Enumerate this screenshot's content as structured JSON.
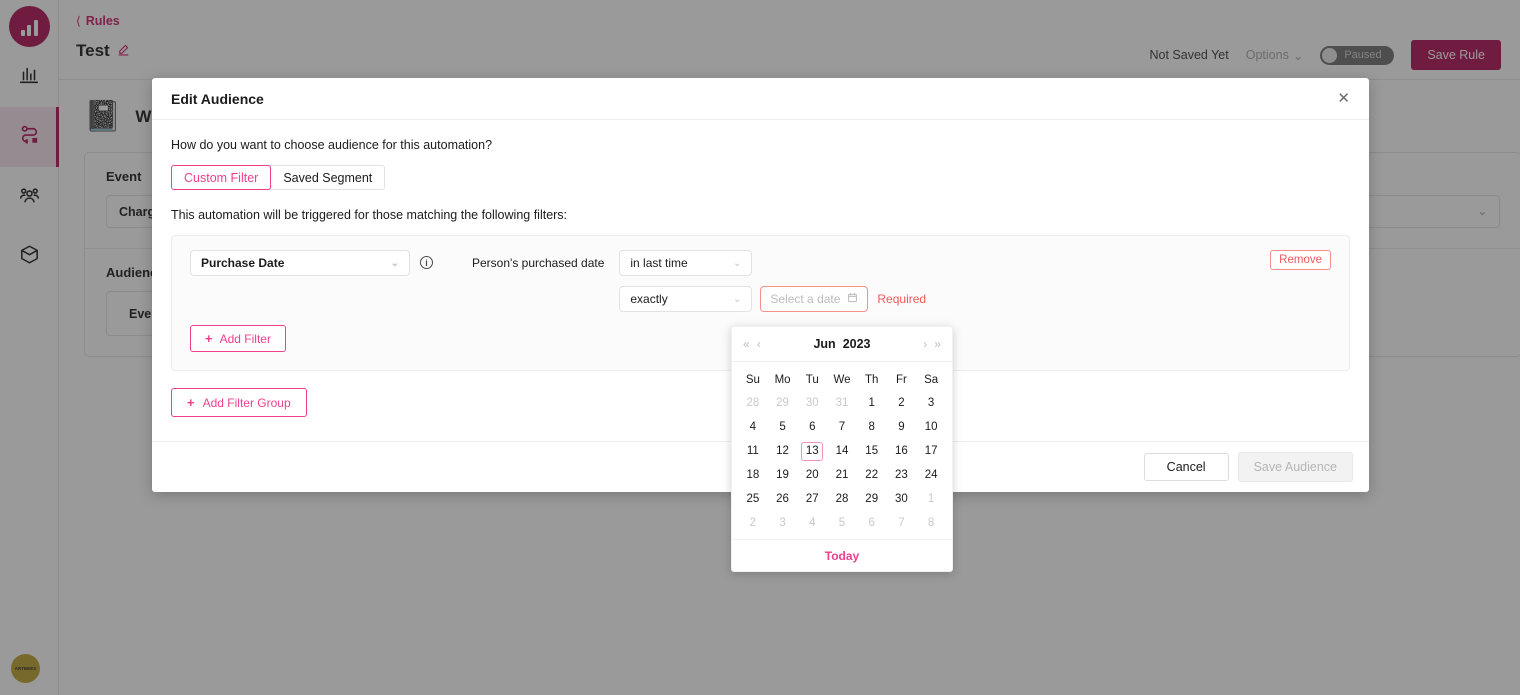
{
  "sidebar": {
    "logo": "bar-chart-logo",
    "items": [
      {
        "name": "analytics",
        "icon": "bar-chart-icon",
        "active": false
      },
      {
        "name": "journeys",
        "icon": "flow-route-icon",
        "active": true
      },
      {
        "name": "audience",
        "icon": "people-group-icon",
        "active": false
      },
      {
        "name": "catalog",
        "icon": "box-package-icon",
        "active": false
      }
    ],
    "brand_badge": "ARTBEES"
  },
  "topbar": {
    "back_link": "Rules",
    "rule_title": "Test",
    "edit_icon": "pencil-icon",
    "status_text": "Not Saved Yet",
    "options_label": "Options",
    "toggle_label": "Paused",
    "save_label": "Save Rule"
  },
  "canvas": {
    "flow_title": "When",
    "flow_emoji": "📓",
    "event_label": "Event",
    "event_value": "Charge",
    "audience_label": "Audience",
    "audience_value": "Everyone"
  },
  "modal": {
    "title": "Edit Audience",
    "close_icon": "close-icon",
    "question": "How do you want to choose audience for this automation?",
    "tabs": [
      {
        "label": "Custom Filter",
        "active": true
      },
      {
        "label": "Saved Segment",
        "active": false
      }
    ],
    "trigger_text": "This automation will be triggered for those matching the following filters:",
    "filter": {
      "attribute": "Purchase Date",
      "info_icon": "info-icon",
      "operator_text": "Person's purchased date",
      "condition": "in last time",
      "sub_condition": "exactly",
      "date_placeholder": "Select a date",
      "calendar_icon": "calendar-icon",
      "validation": "Required",
      "remove_label": "Remove"
    },
    "add_filter_label": "Add Filter",
    "add_filter_group_label": "Add Filter Group",
    "cancel_label": "Cancel",
    "save_label": "Save Audience"
  },
  "datepicker": {
    "prev_year_icon": "double-chevron-left-icon",
    "prev_month_icon": "chevron-left-icon",
    "next_month_icon": "chevron-right-icon",
    "next_year_icon": "double-chevron-right-icon",
    "month": "Jun",
    "year": "2023",
    "weekdays": [
      "Su",
      "Mo",
      "Tu",
      "We",
      "Th",
      "Fr",
      "Sa"
    ],
    "weeks": [
      [
        {
          "d": "28",
          "m": true
        },
        {
          "d": "29",
          "m": true
        },
        {
          "d": "30",
          "m": true
        },
        {
          "d": "31",
          "m": true
        },
        {
          "d": "1"
        },
        {
          "d": "2"
        },
        {
          "d": "3"
        }
      ],
      [
        {
          "d": "4"
        },
        {
          "d": "5"
        },
        {
          "d": "6"
        },
        {
          "d": "7"
        },
        {
          "d": "8"
        },
        {
          "d": "9"
        },
        {
          "d": "10"
        }
      ],
      [
        {
          "d": "11"
        },
        {
          "d": "12"
        },
        {
          "d": "13",
          "today": true
        },
        {
          "d": "14"
        },
        {
          "d": "15"
        },
        {
          "d": "16"
        },
        {
          "d": "17"
        }
      ],
      [
        {
          "d": "18"
        },
        {
          "d": "19"
        },
        {
          "d": "20"
        },
        {
          "d": "21"
        },
        {
          "d": "22"
        },
        {
          "d": "23"
        },
        {
          "d": "24"
        }
      ],
      [
        {
          "d": "25"
        },
        {
          "d": "26"
        },
        {
          "d": "27"
        },
        {
          "d": "28"
        },
        {
          "d": "29"
        },
        {
          "d": "30"
        },
        {
          "d": "1",
          "m": true
        }
      ],
      [
        {
          "d": "2",
          "m": true
        },
        {
          "d": "3",
          "m": true
        },
        {
          "d": "4",
          "m": true
        },
        {
          "d": "5",
          "m": true
        },
        {
          "d": "6",
          "m": true
        },
        {
          "d": "7",
          "m": true
        },
        {
          "d": "8",
          "m": true
        }
      ]
    ],
    "today_label": "Today"
  },
  "colors": {
    "brand": "#b01257",
    "accent_pink": "#ef3f8f",
    "danger": "#f05b5b"
  }
}
